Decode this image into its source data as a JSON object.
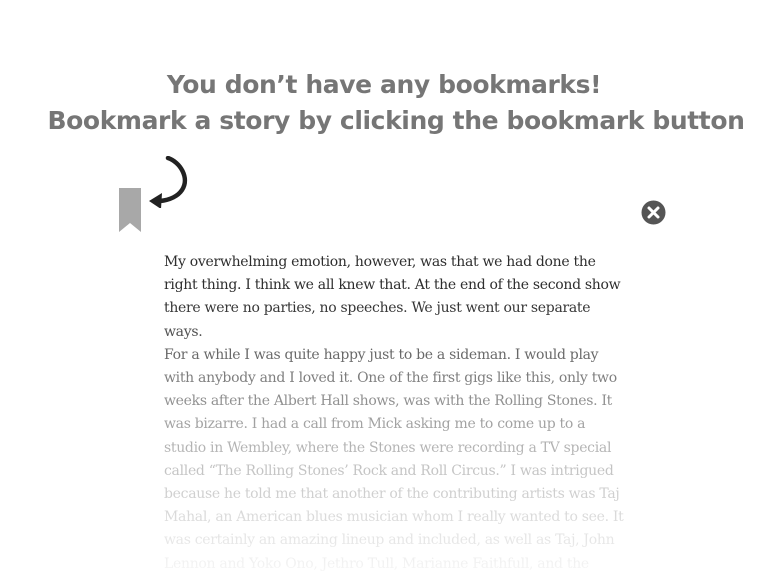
{
  "empty_state": {
    "title_line1": "You don’t have any bookmarks!",
    "title_line2": "Bookmark a story by clicking the bookmark button"
  },
  "icons": {
    "bookmark": "bookmark-icon",
    "arrow": "curved-arrow-icon",
    "close": "close-icon"
  },
  "colors": {
    "heading": "#767676",
    "bookmark_icon": "#a8a8a8",
    "arrow_icon": "#222222",
    "close_button": "#555555",
    "story_text": "#2e2e2e"
  },
  "story": {
    "paragraphs": [
      "My overwhelming emotion, however, was that we had done the right thing. I think we all knew that. At the end of the second show there were no parties, no speeches. We just went our separate ways.",
      "For a while I was quite happy just to be a sideman. I would play with anybody and I loved it. One of the first gigs like this, only two weeks after the Albert Hall shows, was with the Rolling Stones. It was bizarre. I had a call from Mick asking me to come up to a studio in Wembley, where the Stones were recording a TV special called “The Rolling Stones’ Rock and Roll Circus.” I was intrigued because he told me that another of the contributing artists was Taj Mahal, an American blues musician whom I really wanted to see. It was certainly an amazing lineup and included, as well as Taj, John Lennon and Yoko Ono, Jethro Tull, Marianne Faithfull, and the Who."
    ]
  }
}
